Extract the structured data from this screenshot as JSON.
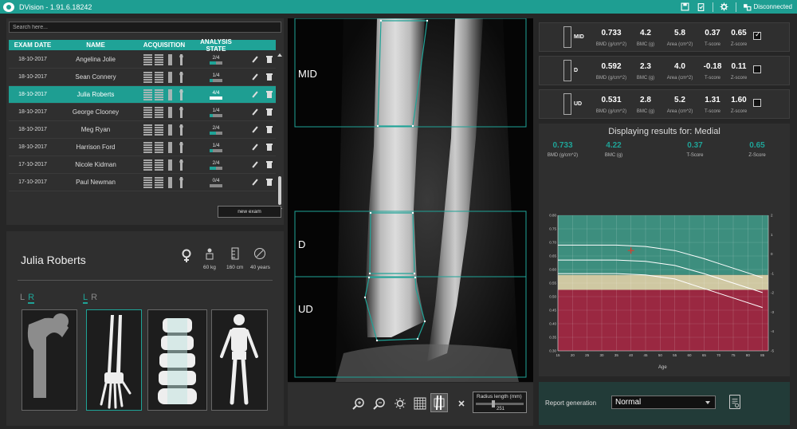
{
  "window": {
    "title": "DVision - 1.91.6.18242",
    "status": "Disconnected"
  },
  "search": {
    "placeholder": "Search here..."
  },
  "table": {
    "headers": [
      "EXAM DATE",
      "NAME",
      "ACQUISITION",
      "ANALYSIS STATE"
    ],
    "rows": [
      {
        "date": "18-10-2017",
        "name": "Angelina Jolie",
        "state": "2/4",
        "progress": 0.5
      },
      {
        "date": "18-10-2017",
        "name": "Sean Connery",
        "state": "1/4",
        "progress": 0.25
      },
      {
        "date": "18-10-2017",
        "name": "Julia Roberts",
        "state": "4/4",
        "progress": 1.0
      },
      {
        "date": "18-10-2017",
        "name": "George Clooney",
        "state": "1/4",
        "progress": 0.25
      },
      {
        "date": "18-10-2017",
        "name": "Meg Ryan",
        "state": "2/4",
        "progress": 0.5
      },
      {
        "date": "18-10-2017",
        "name": "Harrison Ford",
        "state": "1/4",
        "progress": 0.25
      },
      {
        "date": "17-10-2017",
        "name": "Nicole Kidman",
        "state": "2/4",
        "progress": 0.5
      },
      {
        "date": "17-10-2017",
        "name": "Paul Newman",
        "state": "0/4",
        "progress": 0.0
      }
    ],
    "new_exam": "new exam"
  },
  "patient": {
    "name": "Julia Roberts",
    "weight": "60 kg",
    "height": "160 cm",
    "age": "40 years",
    "sel_a": {
      "l": "L",
      "r": "R"
    },
    "sel_b": {
      "l": "L",
      "r": "R"
    }
  },
  "regions": {
    "mid": "MID",
    "d": "D",
    "ud": "UD"
  },
  "radius": {
    "label": "Radius length (mm)",
    "value": "251"
  },
  "results": [
    {
      "tag": "MID",
      "bmd": "0.733",
      "bmc": "4.2",
      "area": "5.8",
      "t": "0.37",
      "z": "0.65",
      "checked": true
    },
    {
      "tag": "D",
      "bmd": "0.592",
      "bmc": "2.3",
      "area": "4.0",
      "t": "-0.18",
      "z": "0.11",
      "checked": false
    },
    {
      "tag": "UD",
      "bmd": "0.531",
      "bmc": "2.8",
      "area": "5.2",
      "t": "1.31",
      "z": "1.60",
      "checked": false
    }
  ],
  "result_labels": {
    "bmd": "BMD (g/cm^2)",
    "bmc": "BMC (g)",
    "area": "Area (cm^2)",
    "t": "T-score",
    "z": "Z-score"
  },
  "display": {
    "title": "Displaying results for: Medial",
    "bmd": "0.733",
    "bmc": "4.22",
    "t": "0.37",
    "z": "0.65",
    "bmd_label": "BMD (g/cm^2)",
    "bmc_label": "BMC (g)",
    "t_label": "T-Score",
    "z_label": "Z-Score"
  },
  "chart_data": {
    "type": "area",
    "xlabel": "Age",
    "x_ticks": [
      15,
      20,
      25,
      30,
      35,
      40,
      45,
      50,
      55,
      60,
      65,
      70,
      75,
      80,
      85
    ],
    "y_left_ticks": [
      "0.80",
      "0.75",
      "0.70",
      "0.65",
      "0.60",
      "0.55",
      "0.50",
      "0.45",
      "0.40",
      "0.35",
      "0.30"
    ],
    "y_right_ticks": [
      "2",
      "1",
      "0",
      "-1",
      "-2",
      "-3",
      "-4",
      "-5"
    ],
    "xlim": [
      15,
      87
    ],
    "ylim": [
      0.3,
      0.8
    ],
    "bands": [
      {
        "from": 0.58,
        "to": 0.8,
        "color": "#3d8e7e"
      },
      {
        "from": 0.525,
        "to": 0.58,
        "color": "#cfc8a2"
      },
      {
        "from": 0.3,
        "to": 0.525,
        "color": "#9a2841"
      }
    ],
    "series": [
      {
        "x": [
          15,
          35,
          45,
          55,
          65,
          75,
          85
        ],
        "y": [
          0.69,
          0.69,
          0.685,
          0.67,
          0.64,
          0.605,
          0.57
        ]
      },
      {
        "x": [
          15,
          35,
          45,
          55,
          65,
          75,
          85
        ],
        "y": [
          0.635,
          0.635,
          0.63,
          0.615,
          0.585,
          0.55,
          0.515
        ]
      },
      {
        "x": [
          15,
          35,
          45,
          55,
          65,
          75,
          85
        ],
        "y": [
          0.585,
          0.585,
          0.58,
          0.565,
          0.53,
          0.495,
          0.46
        ]
      }
    ],
    "marker": {
      "x": 40,
      "y": 0.67
    }
  },
  "report": {
    "label": "Report generation",
    "value": "Normal"
  },
  "colors": {
    "accent": "#1fa397",
    "titlebar": "#1e9e92"
  }
}
